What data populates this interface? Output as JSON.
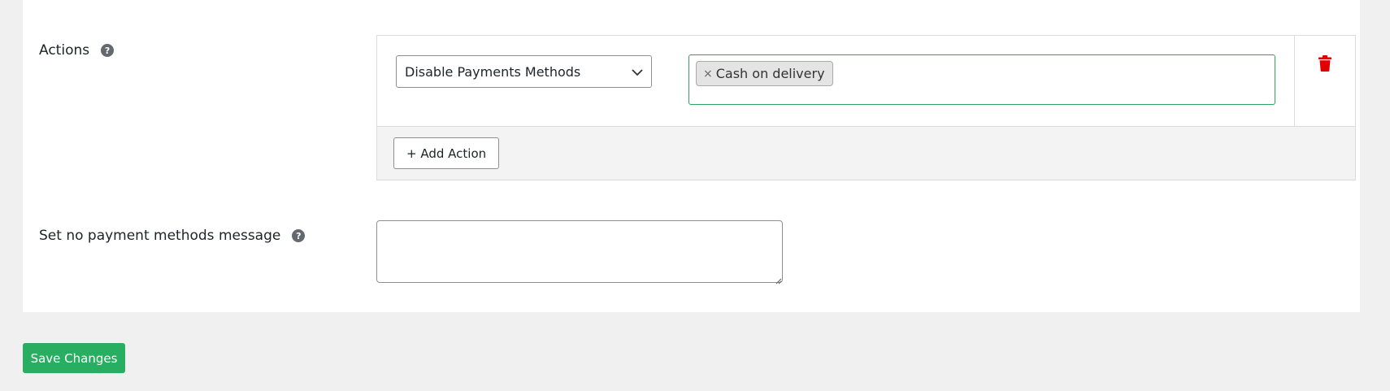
{
  "actions": {
    "label": "Actions",
    "help_icon": "question-circle-icon",
    "selected_action": "Disable Payments Methods",
    "selected_tags": [
      {
        "label": "Cash on delivery",
        "remove": "×"
      }
    ],
    "add_action_label": "+ Add Action",
    "delete_icon": "trash-icon",
    "delete_color": "#e00000",
    "tag_border_color": "#2ea55f"
  },
  "no_payment_message": {
    "label": "Set no payment methods message",
    "help_icon": "question-circle-icon",
    "value": ""
  },
  "footer": {
    "save_label": "Save Changes",
    "save_color": "#27ae60"
  }
}
